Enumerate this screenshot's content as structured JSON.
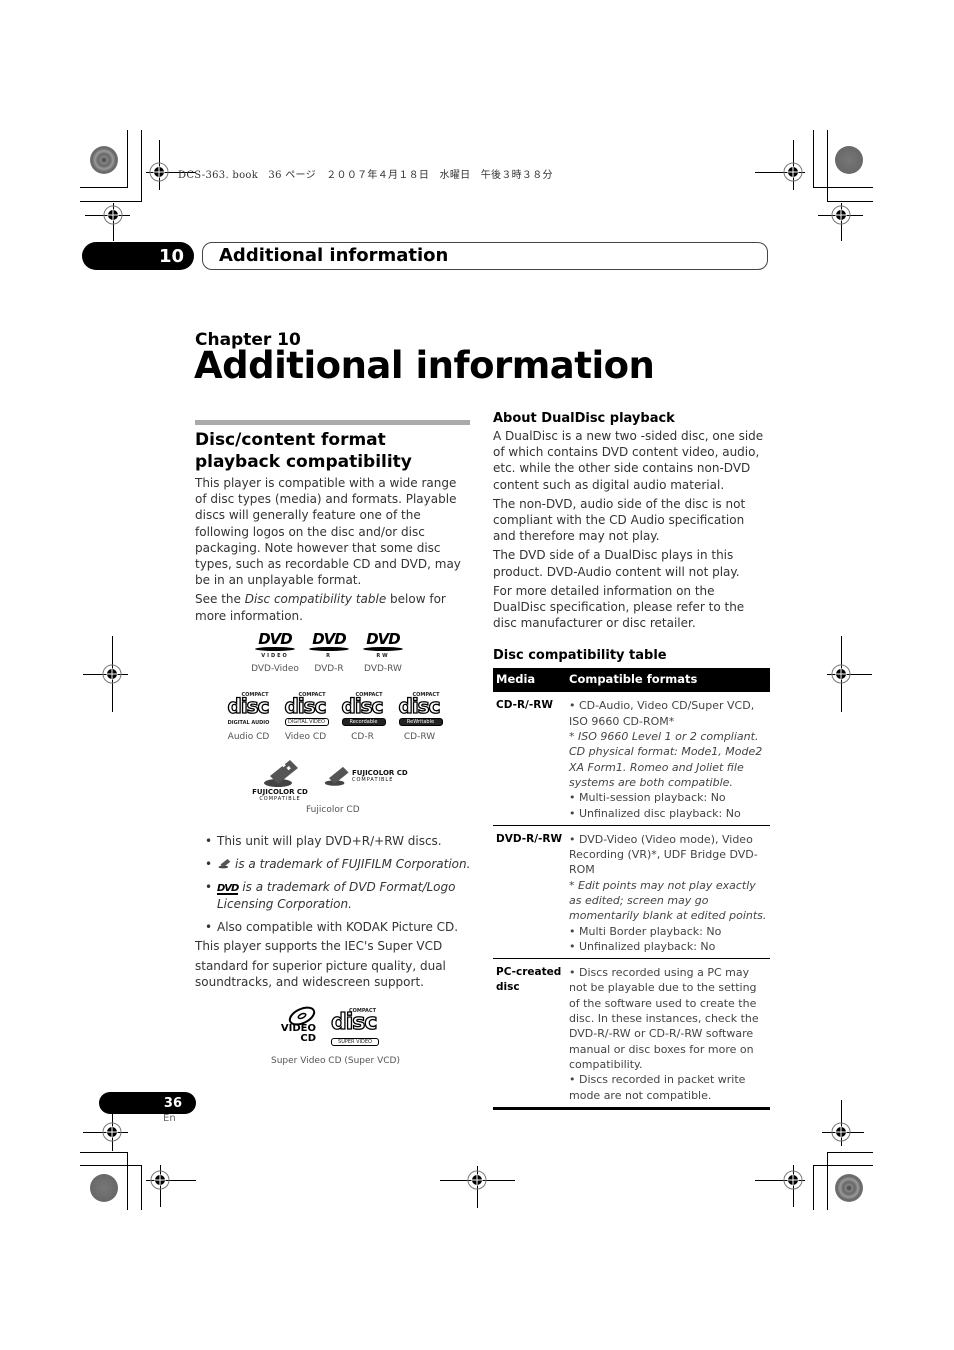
{
  "slug": "DCS-363. book　36 ページ　２００７年４月１８日　水曜日　午後３時３８分",
  "header": {
    "chapter_number": "10",
    "chapter_heading": "Additional information"
  },
  "chapter": {
    "label": "Chapter 10",
    "title": "Additional information"
  },
  "left": {
    "section_title": "Disc/content format playback compatibility",
    "intro": "This player is compatible with a wide range of disc types (media) and formats. Playable discs will generally feature one of the following logos on the disc and/or disc packaging. Note however that some disc types, such as recordable CD and DVD, may be in an unplayable format.",
    "see_prefix": "See the ",
    "see_ref": "Disc compatibility table",
    "see_suffix": " below for more information.",
    "dvd_logos": [
      {
        "mark": "DVD",
        "sub": "VIDEO",
        "caption": "DVD-Video"
      },
      {
        "mark": "DVD",
        "sub": "R",
        "caption": "DVD-R"
      },
      {
        "mark": "DVD",
        "sub": "RW",
        "caption": "DVD-RW"
      }
    ],
    "cd_logos": [
      {
        "top": "COMPACT",
        "mark": "disc",
        "band": "DIGITAL AUDIO",
        "caption": "Audio CD"
      },
      {
        "top": "COMPACT",
        "mark": "disc",
        "band": "DIGITAL VIDEO",
        "caption": "Video CD"
      },
      {
        "top": "COMPACT",
        "mark": "disc",
        "band": "Recordable",
        "caption": "CD-R"
      },
      {
        "top": "COMPACT",
        "mark": "disc",
        "band": "ReWritable",
        "caption": "CD-RW"
      }
    ],
    "fuji_logos": {
      "name": "FUJICOLOR CD",
      "sub": "COMPATIBLE",
      "caption": "Fujicolor CD"
    },
    "bullets": [
      {
        "text": "This unit will play DVD+R/+RW discs.",
        "italic": false
      },
      {
        "text": "is a trademark of FUJIFILM Corporation.",
        "italic": true
      },
      {
        "text": "is a trademark of DVD Format/Logo Licensing Corporation.",
        "italic": true,
        "mark": "DVD"
      },
      {
        "text": "Also compatible with KODAK Picture CD.",
        "italic": false
      }
    ],
    "svcd_p1": "This player supports the IEC's Super VCD",
    "svcd_p2": "standard for superior picture quality, dual soundtracks, and widescreen support.",
    "svcd_logos": {
      "vcd_mark": "VIDEO CD",
      "cd_top": "COMPACT",
      "cd_mark": "disc",
      "cd_band": "SUPER VIDEO",
      "caption": "Super Video CD (Super VCD)"
    }
  },
  "right": {
    "dualdisc_title": "About DualDisc playback",
    "dualdisc_paragraphs": [
      "A DualDisc is a new two -sided disc, one side of which contains DVD content video, audio, etc. while the other side contains non-DVD content such as digital audio material.",
      "The non-DVD, audio side of the disc is not compliant with the CD Audio specification and therefore may not play.",
      "The DVD side of a DualDisc plays in this product. DVD-Audio content will not play.",
      "For more detailed information on the DualDisc specification, please refer to the disc manufacturer or disc retailer."
    ],
    "table_title": "Disc compatibility table",
    "table": {
      "headers": [
        "Media",
        "Compatible formats"
      ],
      "rows": [
        {
          "media": "CD-R/-RW",
          "lines": [
            {
              "type": "text",
              "text": "• CD-Audio, Video CD/Super VCD, ISO 9660 CD-ROM*"
            },
            {
              "type": "note",
              "text": "* ISO 9660 Level 1 or 2 compliant. CD physical format: Mode1, Mode2 XA Form1. Romeo and Joliet file systems are both compatible."
            },
            {
              "type": "bullet",
              "text": "• Multi-session playback: No"
            },
            {
              "type": "bullet",
              "text": "• Unfinalized disc playback: No"
            }
          ]
        },
        {
          "media": "DVD-R/-RW",
          "lines": [
            {
              "type": "text",
              "text": "• DVD-Video (Video mode), Video Recording (VR)*, UDF Bridge DVD-ROM"
            },
            {
              "type": "note",
              "text": "* Edit points may not play exactly as edited; screen may go momentarily blank at edited points."
            },
            {
              "type": "bullet",
              "text": "• Multi Border playback: No"
            },
            {
              "type": "bullet",
              "text": "• Unfinalized playback: No"
            }
          ]
        },
        {
          "media": "PC-created disc",
          "lines": [
            {
              "type": "text",
              "text": "• Discs recorded using a PC may not be playable due to the setting of the software used to create the disc. In these instances, check the DVD-R/-RW or CD-R/-RW software manual or disc boxes for more on compatibility."
            },
            {
              "type": "bullet",
              "text": "• Discs recorded in packet write mode are not compatible."
            }
          ]
        }
      ]
    }
  },
  "footer": {
    "page_number": "36",
    "language": "En"
  }
}
